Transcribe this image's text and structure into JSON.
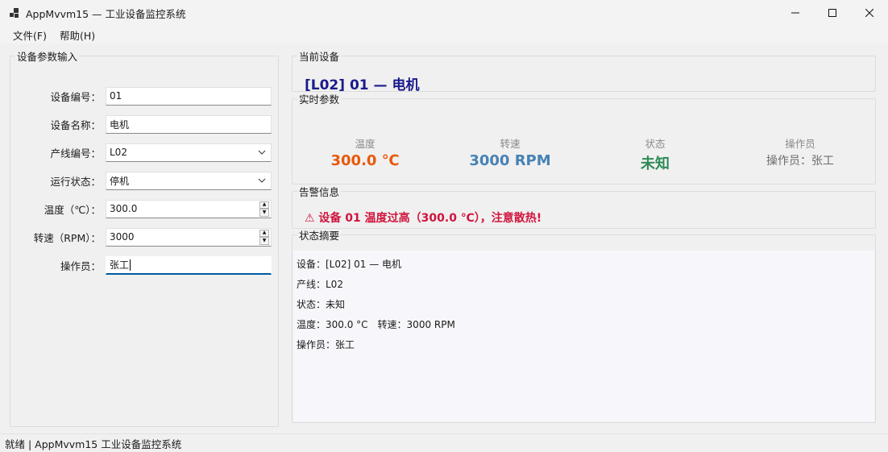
{
  "window": {
    "title": "AppMvvm15 — 工业设备监控系统",
    "controls": {
      "minimize": "minimize-icon",
      "maximize": "maximize-icon",
      "close": "close-icon"
    }
  },
  "menu": {
    "file": "文件(F)",
    "help": "帮助(H)"
  },
  "input_panel": {
    "legend": "设备参数输入",
    "fields": [
      {
        "label": "设备编号：",
        "value": "01"
      },
      {
        "label": "设备名称：",
        "value": "电机"
      },
      {
        "label": "产线编号：",
        "value": "L02"
      },
      {
        "label": "运行状态：",
        "value": "停机"
      },
      {
        "label": "温度（℃）：",
        "value": "300.0"
      },
      {
        "label": "转速（RPM）：",
        "value": "3000"
      },
      {
        "label": "操作员：",
        "value": "张工"
      }
    ]
  },
  "current_device": {
    "legend": "当前设备",
    "title": "[L02] 01 — 电机"
  },
  "realtime": {
    "legend": "实时参数",
    "metrics": [
      {
        "label": "温度",
        "value": "300.0 ℃",
        "color": "#e8590c"
      },
      {
        "label": "转速",
        "value": "3000 RPM",
        "color": "#4682b4"
      },
      {
        "label": "状态",
        "value": "未知",
        "color": "#2e8b57"
      },
      {
        "label": "操作员",
        "value": "操作员：张工",
        "color": "#6b6b6b"
      }
    ]
  },
  "alarm": {
    "legend": "告警信息",
    "text": "⚠ 设备 01 温度过高（300.0 ℃），注意散热!",
    "color": "#d0143c"
  },
  "summary": {
    "legend": "状态摘要",
    "lines": [
      "设备：[L02] 01 — 电机",
      "产线：L02",
      "状态：未知",
      "温度：300.0 °C　转速：3000 RPM",
      "操作员：张工"
    ]
  },
  "statusbar": {
    "text": "就绪 | AppMvvm15 工业设备监控系统"
  }
}
